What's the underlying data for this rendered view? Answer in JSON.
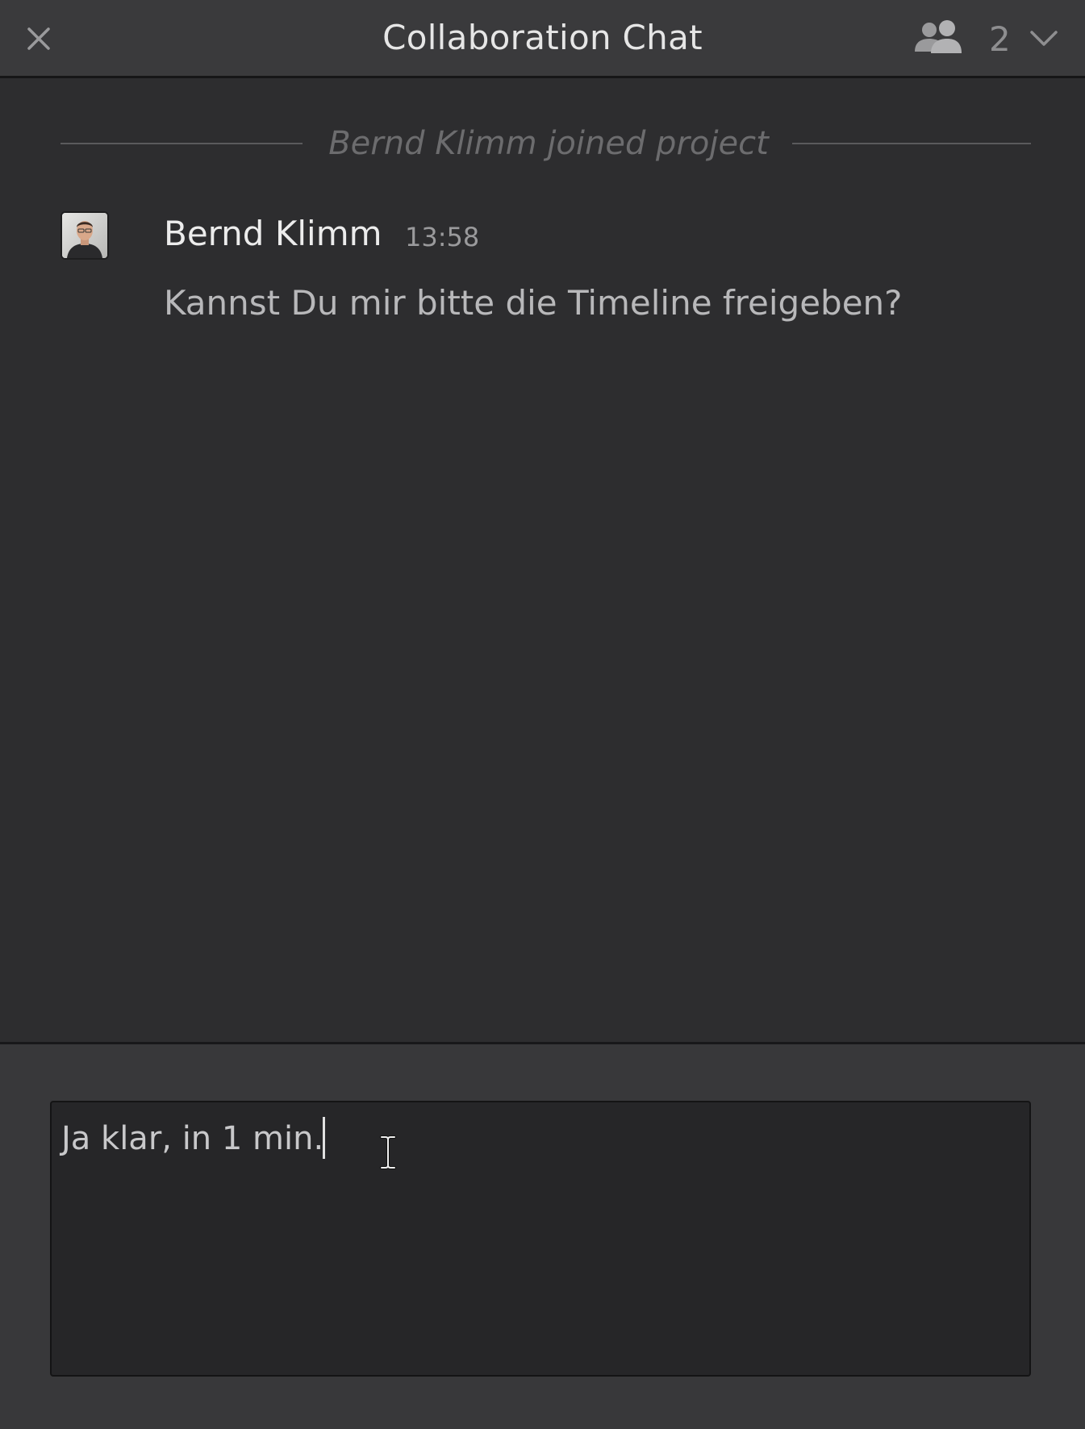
{
  "header": {
    "title": "Collaboration Chat",
    "user_count": "2",
    "icons": {
      "close": "close-icon",
      "users": "users-icon",
      "dropdown": "chevron-down-icon"
    }
  },
  "messages": {
    "system_notice": "Bernd Klimm joined project",
    "items": [
      {
        "sender": "Bernd Klimm",
        "time": "13:58",
        "text": "Kannst Du mir bitte die Timeline freigeben?",
        "avatar": "avatar-photo"
      }
    ]
  },
  "compose": {
    "value": "Ja klar, in 1 min.",
    "cursor_icon": "text-cursor-icon"
  },
  "colors": {
    "background": "#2d2d2f",
    "header": "#3a3a3c",
    "input": "#262628",
    "title_text": "#e6e6e6",
    "muted_text": "#6c6c6e"
  }
}
